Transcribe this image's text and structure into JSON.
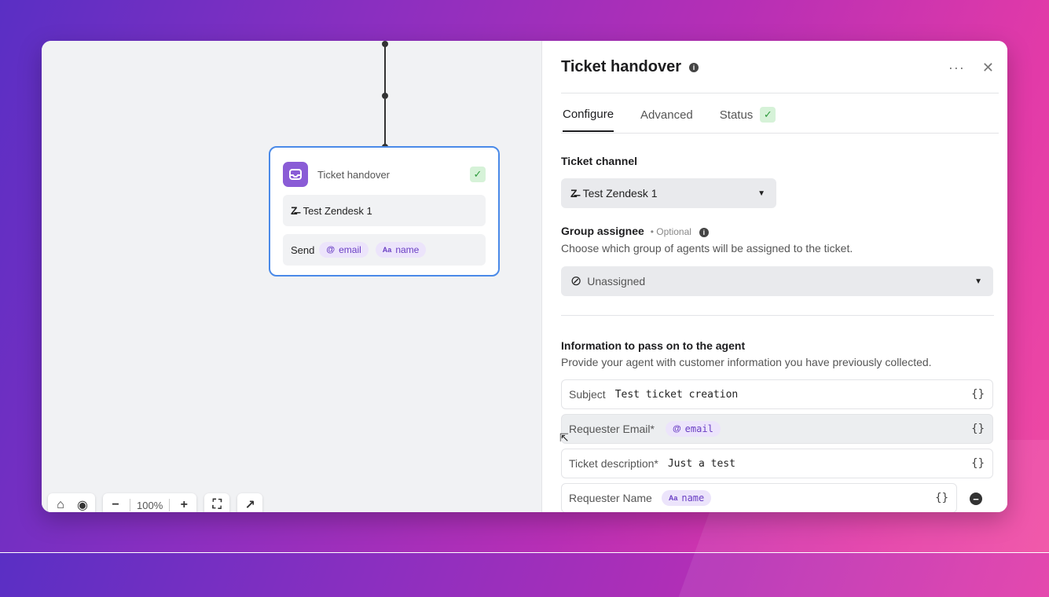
{
  "canvas": {
    "node": {
      "title": "Ticket handover",
      "channel": "Test Zendesk 1",
      "send_label": "Send",
      "chips": [
        {
          "icon": "@",
          "label": "email"
        },
        {
          "icon": "Aa",
          "label": "name"
        }
      ]
    },
    "toolbar": {
      "zoom": "100%"
    }
  },
  "panel": {
    "title": "Ticket handover",
    "tabs": [
      {
        "label": "Configure"
      },
      {
        "label": "Advanced"
      },
      {
        "label": "Status"
      }
    ],
    "ticket_channel": {
      "label": "Ticket channel",
      "value": "Test Zendesk 1"
    },
    "group_assignee": {
      "label": "Group assignee",
      "optional": "• Optional",
      "description": "Choose which group of agents will be assigned to the ticket.",
      "value": "Unassigned"
    },
    "info": {
      "label": "Information to pass on to the agent",
      "description": "Provide your agent with customer information you have previously collected.",
      "fields": [
        {
          "label": "Subject",
          "value": "Test ticket creation"
        },
        {
          "label": "Requester Email*",
          "chip_icon": "@",
          "chip_label": "email"
        },
        {
          "label": "Ticket description*",
          "value": "Just a test"
        },
        {
          "label": "Requester Name",
          "chip_icon": "Aa",
          "chip_label": "name"
        }
      ],
      "braces": "{}"
    }
  }
}
